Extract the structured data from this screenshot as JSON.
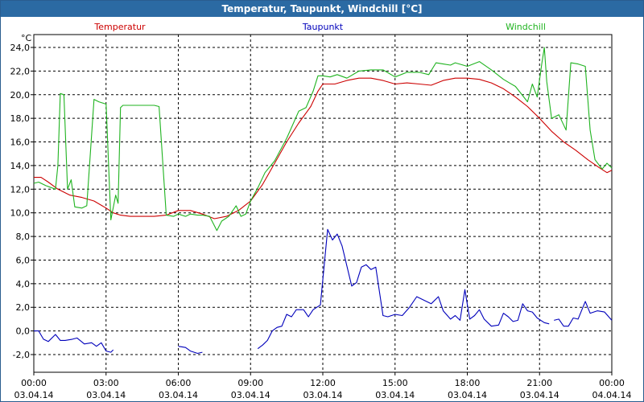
{
  "window": {
    "title": "Temperatur, Taupunkt, Windchill [°C]"
  },
  "colors": {
    "titlebar": "#2b6aa3",
    "temperatur": "#cc0000",
    "taupunkt": "#0000bb",
    "windchill": "#1fb31f",
    "grid": "#000000"
  },
  "chart_data": {
    "type": "line",
    "title": "Temperatur, Taupunkt, Windchill [°C]",
    "ylabel": "°C",
    "xlabel": "",
    "ylim": [
      -3,
      25
    ],
    "xlim": [
      0,
      24
    ],
    "grid": true,
    "legend": "top",
    "y_ticks": [
      "24,0",
      "22,0",
      "20,0",
      "18,0",
      "16,0",
      "14,0",
      "12,0",
      "10,0",
      "8,0",
      "6,0",
      "4,0",
      "2,0",
      "0,0",
      "-2,0"
    ],
    "x_ticks": [
      {
        "time": "00:00",
        "date": "03.04.14"
      },
      {
        "time": "03:00",
        "date": "03.04.14"
      },
      {
        "time": "06:00",
        "date": "03.04.14"
      },
      {
        "time": "09:00",
        "date": "03.04.14"
      },
      {
        "time": "12:00",
        "date": "03.04.14"
      },
      {
        "time": "15:00",
        "date": "03.04.14"
      },
      {
        "time": "18:00",
        "date": "03.04.14"
      },
      {
        "time": "21:00",
        "date": "03.04.14"
      },
      {
        "time": "00:00",
        "date": "04.04.14"
      }
    ],
    "series": [
      {
        "name": "Temperatur",
        "points": [
          [
            0,
            13.0
          ],
          [
            0.3,
            13.0
          ],
          [
            0.6,
            12.6
          ],
          [
            1.0,
            12.0
          ],
          [
            1.5,
            11.5
          ],
          [
            2.0,
            11.3
          ],
          [
            2.5,
            11.0
          ],
          [
            3.0,
            10.4
          ],
          [
            3.3,
            10.0
          ],
          [
            3.6,
            9.8
          ],
          [
            4.0,
            9.7
          ],
          [
            4.5,
            9.7
          ],
          [
            5.0,
            9.7
          ],
          [
            5.5,
            9.8
          ],
          [
            6.0,
            10.2
          ],
          [
            6.5,
            10.2
          ],
          [
            7.0,
            9.9
          ],
          [
            7.5,
            9.5
          ],
          [
            8.0,
            9.7
          ],
          [
            8.5,
            10.2
          ],
          [
            9.0,
            11.0
          ],
          [
            9.5,
            12.4
          ],
          [
            10.0,
            14.2
          ],
          [
            10.5,
            16.0
          ],
          [
            11.0,
            17.6
          ],
          [
            11.5,
            19.0
          ],
          [
            11.8,
            20.3
          ],
          [
            12.0,
            20.9
          ],
          [
            12.5,
            20.9
          ],
          [
            13.0,
            21.2
          ],
          [
            13.5,
            21.4
          ],
          [
            14.0,
            21.4
          ],
          [
            14.5,
            21.2
          ],
          [
            15.0,
            20.9
          ],
          [
            15.5,
            21.0
          ],
          [
            16.0,
            20.9
          ],
          [
            16.5,
            20.8
          ],
          [
            17.0,
            21.2
          ],
          [
            17.5,
            21.4
          ],
          [
            18.0,
            21.4
          ],
          [
            18.5,
            21.3
          ],
          [
            19.0,
            21.0
          ],
          [
            19.5,
            20.5
          ],
          [
            20.0,
            19.8
          ],
          [
            20.5,
            19.0
          ],
          [
            21.0,
            18.0
          ],
          [
            21.5,
            16.9
          ],
          [
            22.0,
            16.0
          ],
          [
            22.5,
            15.3
          ],
          [
            23.0,
            14.5
          ],
          [
            23.5,
            13.8
          ],
          [
            23.8,
            13.4
          ],
          [
            24.0,
            13.6
          ]
        ]
      },
      {
        "name": "Taupunkt",
        "segments": [
          [
            [
              0,
              0.0
            ],
            [
              0.2,
              0.0
            ],
            [
              0.4,
              -0.7
            ],
            [
              0.6,
              -0.9
            ],
            [
              0.9,
              -0.3
            ],
            [
              1.1,
              -0.8
            ],
            [
              1.3,
              -0.8
            ],
            [
              1.6,
              -0.7
            ],
            [
              1.8,
              -0.6
            ],
            [
              2.1,
              -1.1
            ],
            [
              2.4,
              -1.0
            ],
            [
              2.6,
              -1.3
            ],
            [
              2.8,
              -1.0
            ],
            [
              3.0,
              -1.7
            ],
            [
              3.2,
              -1.8
            ],
            [
              3.3,
              -1.6
            ]
          ],
          [
            [
              6.0,
              -1.3
            ],
            [
              6.3,
              -1.4
            ],
            [
              6.5,
              -1.7
            ],
            [
              6.8,
              -1.9
            ],
            [
              7.0,
              -1.8
            ]
          ],
          [
            [
              9.3,
              -1.5
            ],
            [
              9.5,
              -1.2
            ],
            [
              9.7,
              -0.8
            ],
            [
              9.9,
              0.0
            ],
            [
              10.1,
              0.3
            ],
            [
              10.3,
              0.4
            ],
            [
              10.5,
              1.4
            ],
            [
              10.7,
              1.2
            ],
            [
              10.9,
              1.8
            ],
            [
              11.2,
              1.8
            ],
            [
              11.4,
              1.2
            ],
            [
              11.6,
              1.8
            ],
            [
              11.9,
              2.2
            ],
            [
              12.2,
              8.6
            ],
            [
              12.4,
              7.7
            ],
            [
              12.6,
              8.2
            ],
            [
              12.8,
              7.2
            ],
            [
              13.0,
              5.5
            ],
            [
              13.2,
              3.8
            ],
            [
              13.4,
              4.1
            ],
            [
              13.6,
              5.4
            ],
            [
              13.8,
              5.6
            ],
            [
              14.0,
              5.2
            ],
            [
              14.2,
              5.4
            ],
            [
              14.5,
              1.3
            ],
            [
              14.7,
              1.2
            ],
            [
              15.0,
              1.4
            ],
            [
              15.3,
              1.3
            ],
            [
              15.6,
              2.0
            ],
            [
              15.9,
              2.9
            ],
            [
              16.2,
              2.6
            ],
            [
              16.5,
              2.3
            ],
            [
              16.8,
              2.9
            ],
            [
              17.0,
              1.7
            ],
            [
              17.3,
              1.0
            ],
            [
              17.5,
              1.3
            ],
            [
              17.7,
              0.9
            ],
            [
              17.9,
              3.5
            ],
            [
              18.1,
              1.0
            ],
            [
              18.3,
              1.3
            ],
            [
              18.5,
              1.8
            ],
            [
              18.7,
              1.0
            ],
            [
              19.0,
              0.4
            ],
            [
              19.3,
              0.5
            ],
            [
              19.5,
              1.5
            ],
            [
              19.7,
              1.2
            ],
            [
              19.9,
              0.8
            ],
            [
              20.1,
              0.9
            ],
            [
              20.3,
              2.3
            ],
            [
              20.5,
              1.7
            ],
            [
              20.7,
              1.6
            ],
            [
              20.9,
              1.1
            ],
            [
              21.2,
              0.7
            ],
            [
              21.4,
              0.6
            ]
          ],
          [
            [
              21.6,
              0.9
            ],
            [
              21.8,
              1.0
            ],
            [
              22.0,
              0.4
            ],
            [
              22.2,
              0.4
            ],
            [
              22.4,
              1.1
            ],
            [
              22.6,
              1.0
            ],
            [
              22.9,
              2.5
            ],
            [
              23.1,
              1.5
            ],
            [
              23.4,
              1.7
            ],
            [
              23.7,
              1.6
            ],
            [
              24.0,
              0.9
            ]
          ]
        ]
      },
      {
        "name": "Windchill",
        "points": [
          [
            0,
            12.5
          ],
          [
            0.2,
            12.6
          ],
          [
            0.5,
            12.3
          ],
          [
            0.9,
            12.0
          ],
          [
            1.0,
            14.0
          ],
          [
            1.1,
            20.1
          ],
          [
            1.25,
            20.0
          ],
          [
            1.4,
            12.0
          ],
          [
            1.55,
            12.8
          ],
          [
            1.7,
            10.5
          ],
          [
            2.0,
            10.4
          ],
          [
            2.2,
            10.6
          ],
          [
            2.5,
            19.6
          ],
          [
            2.7,
            19.4
          ],
          [
            3.0,
            19.2
          ],
          [
            3.2,
            9.4
          ],
          [
            3.4,
            11.5
          ],
          [
            3.5,
            10.8
          ],
          [
            3.6,
            18.9
          ],
          [
            3.7,
            19.1
          ],
          [
            4.0,
            19.1
          ],
          [
            5.0,
            19.1
          ],
          [
            5.2,
            19.0
          ],
          [
            5.5,
            9.8
          ],
          [
            5.8,
            9.7
          ],
          [
            6.0,
            9.9
          ],
          [
            6.3,
            9.7
          ],
          [
            6.5,
            9.9
          ],
          [
            6.8,
            9.8
          ],
          [
            7.0,
            9.8
          ],
          [
            7.3,
            9.7
          ],
          [
            7.6,
            8.5
          ],
          [
            7.8,
            9.3
          ],
          [
            8.1,
            9.7
          ],
          [
            8.4,
            10.6
          ],
          [
            8.6,
            9.7
          ],
          [
            8.8,
            9.9
          ],
          [
            9.0,
            11.0
          ],
          [
            9.3,
            12.1
          ],
          [
            9.6,
            13.4
          ],
          [
            10.0,
            14.4
          ],
          [
            10.5,
            16.3
          ],
          [
            11.0,
            18.6
          ],
          [
            11.3,
            18.9
          ],
          [
            11.6,
            20.3
          ],
          [
            11.8,
            21.6
          ],
          [
            12.0,
            21.6
          ],
          [
            12.3,
            21.5
          ],
          [
            12.6,
            21.7
          ],
          [
            13.0,
            21.4
          ],
          [
            13.5,
            22.0
          ],
          [
            14.0,
            22.1
          ],
          [
            14.5,
            22.1
          ],
          [
            15.0,
            21.5
          ],
          [
            15.5,
            21.9
          ],
          [
            16.0,
            21.9
          ],
          [
            16.4,
            21.7
          ],
          [
            16.7,
            22.7
          ],
          [
            17.0,
            22.6
          ],
          [
            17.3,
            22.5
          ],
          [
            17.5,
            22.7
          ],
          [
            18.0,
            22.4
          ],
          [
            18.5,
            22.8
          ],
          [
            19.0,
            22.1
          ],
          [
            19.5,
            21.3
          ],
          [
            20.0,
            20.7
          ],
          [
            20.5,
            19.4
          ],
          [
            20.7,
            20.9
          ],
          [
            20.9,
            19.8
          ],
          [
            21.1,
            22.7
          ],
          [
            21.2,
            24.0
          ],
          [
            21.3,
            21.1
          ],
          [
            21.5,
            18.0
          ],
          [
            21.8,
            18.3
          ],
          [
            22.1,
            17.0
          ],
          [
            22.3,
            22.7
          ],
          [
            22.6,
            22.6
          ],
          [
            22.9,
            22.4
          ],
          [
            23.1,
            17.0
          ],
          [
            23.3,
            14.5
          ],
          [
            23.6,
            13.7
          ],
          [
            23.8,
            14.2
          ],
          [
            24.0,
            13.8
          ]
        ]
      }
    ]
  }
}
